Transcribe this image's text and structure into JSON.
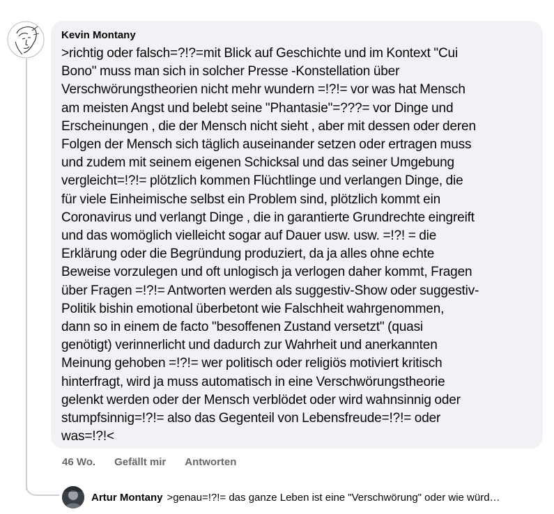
{
  "comment": {
    "author": "Kevin Montany",
    "text": ">richtig oder falsch=?!?=mit Blick auf Geschichte und im Kontext \"Cui\nBono\" muss man sich in solcher  Presse -Konstellation über\nVerschwörungstheorien nicht mehr wundern =!?!= vor was hat Mensch\nam meisten Angst und belebt seine \"Phantasie\"=???=  vor Dinge und\nErscheinungen , die der Mensch nicht sieht , aber mit dessen oder deren\nFolgen der Mensch sich täglich auseinander setzen oder ertragen muss\nund zudem mit seinem eigenen Schicksal und das seiner Umgebung\nvergleicht=!?!= plötzlich kommen Flüchtlinge und verlangen Dinge, die\nfür viele Einheimische selbst ein Problem sind,  plötzlich kommt ein\nCoronavirus und verlangt Dinge , die in garantierte Grundrechte eingreift\nund das womöglich vielleicht sogar auf Dauer usw. usw. =!?! = die\nErklärung oder die Begründung produziert, da ja alles ohne echte\nBeweise vorzulegen und oft unlogisch ja verlogen daher kommt,  Fragen\nüber Fragen =!?!= Antworten werden als suggestiv-Show oder suggestiv-\nPolitik bishin emotional überbetont wie Falschheit wahrgenommen,\ndann so in einem de facto \"besoffenen Zustand versetzt\" (quasi\ngenötigt)  verinnerlicht und dadurch zur Wahrheit und anerkannten\nMeinung gehoben =!?!= wer politisch oder religiös motiviert kritisch\nhinterfragt,  wird ja muss automatisch in eine Verschwörungstheorie\ngelenkt werden oder der Mensch verblödet oder wird wahnsinnig oder\nstumpfsinnig=!?!= also das Gegenteil von Lebensfreude=!?!= oder\nwas=!?!<",
    "time": "46 Wo.",
    "like_label": "Gefällt mir",
    "reply_label": "Antworten"
  },
  "reply": {
    "author": "Artur Montany",
    "preview": ">genau=!?!= das ganze Leben ist eine \"Verschwörung\" oder wie würd…"
  },
  "colors": {
    "bubble": "#f0f2f5",
    "meta": "#65676b",
    "thread_line": "#ced0d4"
  },
  "icons": {
    "author_avatar": "line-sketch-face",
    "reply_avatar": "dark-photo"
  }
}
